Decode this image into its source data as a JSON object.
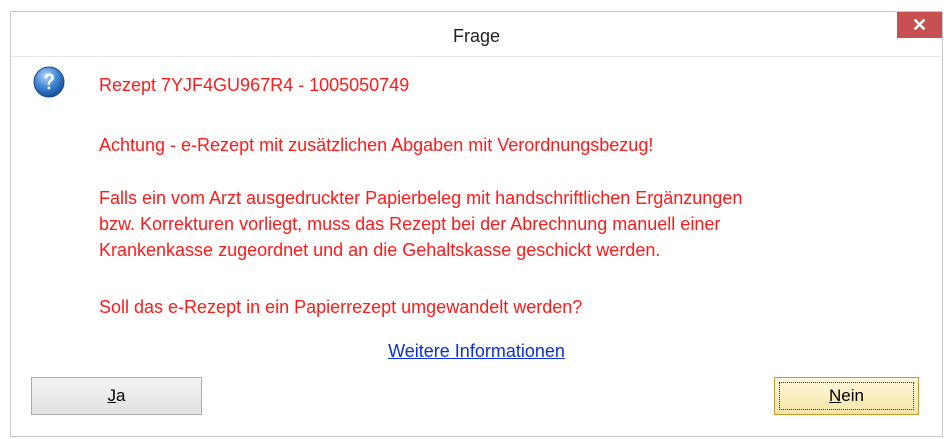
{
  "window": {
    "title": "Frage",
    "close_glyph": "✕"
  },
  "icon": "question-icon",
  "message": {
    "line1": "Rezept 7YJF4GU967R4 - 1005050749",
    "line2": "Achtung - e-Rezept mit zusätzlichen Abgaben mit Verordnungsbezug!",
    "line3a": "Falls ein vom Arzt ausgedruckter Papierbeleg mit handschriftlichen Ergänzungen",
    "line3b": "bzw. Korrekturen vorliegt, muss das Rezept bei der Abrechnung manuell einer",
    "line3c": "Krankenkasse zugeordnet und an die Gehaltskasse geschickt werden.",
    "line4": "Soll das e-Rezept in ein Papierrezept umgewandelt werden?"
  },
  "link": "Weitere Informationen",
  "buttons": {
    "yes_accel": "J",
    "yes_rest": "a",
    "no_accel": "N",
    "no_rest": "ein"
  },
  "colors": {
    "message_text": "#ff1a1a",
    "link": "#0b2fd6",
    "close_button": "#c75050"
  }
}
